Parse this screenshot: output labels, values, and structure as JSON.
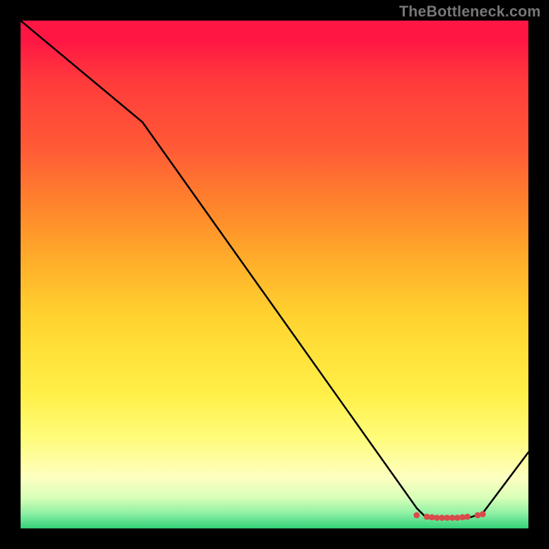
{
  "watermark": "TheBottleneck.com",
  "chart_data": {
    "type": "line",
    "title": "",
    "xlabel": "",
    "ylabel": "",
    "xlim": [
      0,
      100
    ],
    "ylim": [
      0,
      100
    ],
    "background_gradient": {
      "top": "#ff1744",
      "mid_upper": "#ff8a2b",
      "mid": "#ffe23a",
      "mid_lower": "#fdffc0",
      "bottom": "#33d17a"
    },
    "series": [
      {
        "name": "bottleneck-curve",
        "color": "#000000",
        "x": [
          0,
          24,
          78,
          80,
          82,
          83,
          85,
          86,
          88,
          91,
          100
        ],
        "values": [
          100,
          80,
          4,
          2,
          2,
          2,
          2,
          2,
          2,
          3,
          15
        ]
      }
    ],
    "markers": {
      "name": "optimal-range",
      "color": "#d94a4a",
      "x": [
        78,
        80,
        81,
        82,
        83,
        84,
        85,
        86,
        87,
        88,
        90,
        91
      ],
      "y": [
        2.6,
        2.3,
        2.2,
        2.1,
        2.1,
        2.1,
        2.1,
        2.1,
        2.2,
        2.3,
        2.6,
        2.8
      ]
    }
  }
}
